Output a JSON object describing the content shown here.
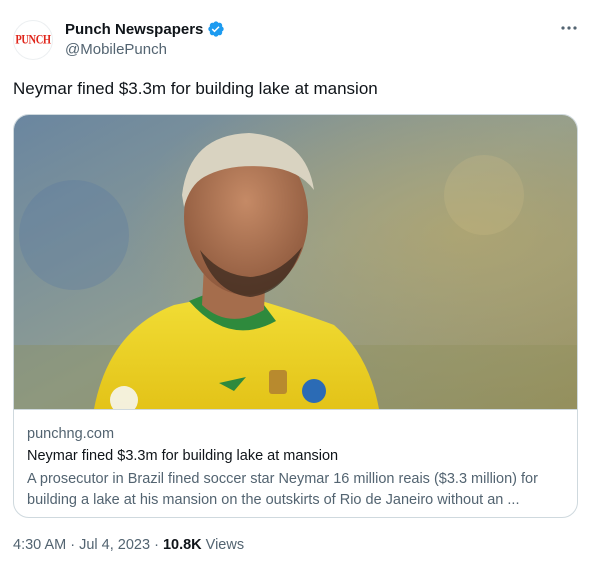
{
  "account": {
    "display_name": "Punch Newspapers",
    "handle": "@MobilePunch",
    "avatar_text": "PUNCH",
    "verified_icon": "verified-badge-icon",
    "more_icon": "more-options-icon"
  },
  "tweet": {
    "text": "Neymar fined $3.3m for building lake at mansion"
  },
  "card": {
    "image_icon": "news-photo-image",
    "domain": "punchng.com",
    "title": "Neymar fined $3.3m for building lake at mansion",
    "description": "A prosecutor in Brazil fined soccer star Neymar 16 million reais ($3.3 million) for building a lake at his mansion on the outskirts of Rio de Janeiro without an ..."
  },
  "meta": {
    "time": "4:30 AM",
    "separator": " · ",
    "date": "Jul 4, 2023",
    "views_count": "10.8K",
    "views_label": "Views"
  },
  "colors": {
    "text_primary": "#0f1419",
    "text_secondary": "#536471",
    "border": "#cfd9de",
    "verified": "#1d9bf0",
    "avatar_red": "#e0261b"
  }
}
